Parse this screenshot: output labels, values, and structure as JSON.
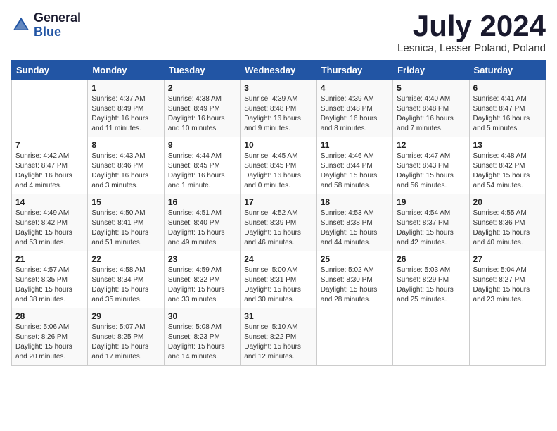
{
  "logo": {
    "general": "General",
    "blue": "Blue"
  },
  "header": {
    "month": "July 2024",
    "location": "Lesnica, Lesser Poland, Poland"
  },
  "weekdays": [
    "Sunday",
    "Monday",
    "Tuesday",
    "Wednesday",
    "Thursday",
    "Friday",
    "Saturday"
  ],
  "weeks": [
    [
      {
        "day": "",
        "info": ""
      },
      {
        "day": "1",
        "info": "Sunrise: 4:37 AM\nSunset: 8:49 PM\nDaylight: 16 hours\nand 11 minutes."
      },
      {
        "day": "2",
        "info": "Sunrise: 4:38 AM\nSunset: 8:49 PM\nDaylight: 16 hours\nand 10 minutes."
      },
      {
        "day": "3",
        "info": "Sunrise: 4:39 AM\nSunset: 8:48 PM\nDaylight: 16 hours\nand 9 minutes."
      },
      {
        "day": "4",
        "info": "Sunrise: 4:39 AM\nSunset: 8:48 PM\nDaylight: 16 hours\nand 8 minutes."
      },
      {
        "day": "5",
        "info": "Sunrise: 4:40 AM\nSunset: 8:48 PM\nDaylight: 16 hours\nand 7 minutes."
      },
      {
        "day": "6",
        "info": "Sunrise: 4:41 AM\nSunset: 8:47 PM\nDaylight: 16 hours\nand 5 minutes."
      }
    ],
    [
      {
        "day": "7",
        "info": "Sunrise: 4:42 AM\nSunset: 8:47 PM\nDaylight: 16 hours\nand 4 minutes."
      },
      {
        "day": "8",
        "info": "Sunrise: 4:43 AM\nSunset: 8:46 PM\nDaylight: 16 hours\nand 3 minutes."
      },
      {
        "day": "9",
        "info": "Sunrise: 4:44 AM\nSunset: 8:45 PM\nDaylight: 16 hours\nand 1 minute."
      },
      {
        "day": "10",
        "info": "Sunrise: 4:45 AM\nSunset: 8:45 PM\nDaylight: 16 hours\nand 0 minutes."
      },
      {
        "day": "11",
        "info": "Sunrise: 4:46 AM\nSunset: 8:44 PM\nDaylight: 15 hours\nand 58 minutes."
      },
      {
        "day": "12",
        "info": "Sunrise: 4:47 AM\nSunset: 8:43 PM\nDaylight: 15 hours\nand 56 minutes."
      },
      {
        "day": "13",
        "info": "Sunrise: 4:48 AM\nSunset: 8:42 PM\nDaylight: 15 hours\nand 54 minutes."
      }
    ],
    [
      {
        "day": "14",
        "info": "Sunrise: 4:49 AM\nSunset: 8:42 PM\nDaylight: 15 hours\nand 53 minutes."
      },
      {
        "day": "15",
        "info": "Sunrise: 4:50 AM\nSunset: 8:41 PM\nDaylight: 15 hours\nand 51 minutes."
      },
      {
        "day": "16",
        "info": "Sunrise: 4:51 AM\nSunset: 8:40 PM\nDaylight: 15 hours\nand 49 minutes."
      },
      {
        "day": "17",
        "info": "Sunrise: 4:52 AM\nSunset: 8:39 PM\nDaylight: 15 hours\nand 46 minutes."
      },
      {
        "day": "18",
        "info": "Sunrise: 4:53 AM\nSunset: 8:38 PM\nDaylight: 15 hours\nand 44 minutes."
      },
      {
        "day": "19",
        "info": "Sunrise: 4:54 AM\nSunset: 8:37 PM\nDaylight: 15 hours\nand 42 minutes."
      },
      {
        "day": "20",
        "info": "Sunrise: 4:55 AM\nSunset: 8:36 PM\nDaylight: 15 hours\nand 40 minutes."
      }
    ],
    [
      {
        "day": "21",
        "info": "Sunrise: 4:57 AM\nSunset: 8:35 PM\nDaylight: 15 hours\nand 38 minutes."
      },
      {
        "day": "22",
        "info": "Sunrise: 4:58 AM\nSunset: 8:34 PM\nDaylight: 15 hours\nand 35 minutes."
      },
      {
        "day": "23",
        "info": "Sunrise: 4:59 AM\nSunset: 8:32 PM\nDaylight: 15 hours\nand 33 minutes."
      },
      {
        "day": "24",
        "info": "Sunrise: 5:00 AM\nSunset: 8:31 PM\nDaylight: 15 hours\nand 30 minutes."
      },
      {
        "day": "25",
        "info": "Sunrise: 5:02 AM\nSunset: 8:30 PM\nDaylight: 15 hours\nand 28 minutes."
      },
      {
        "day": "26",
        "info": "Sunrise: 5:03 AM\nSunset: 8:29 PM\nDaylight: 15 hours\nand 25 minutes."
      },
      {
        "day": "27",
        "info": "Sunrise: 5:04 AM\nSunset: 8:27 PM\nDaylight: 15 hours\nand 23 minutes."
      }
    ],
    [
      {
        "day": "28",
        "info": "Sunrise: 5:06 AM\nSunset: 8:26 PM\nDaylight: 15 hours\nand 20 minutes."
      },
      {
        "day": "29",
        "info": "Sunrise: 5:07 AM\nSunset: 8:25 PM\nDaylight: 15 hours\nand 17 minutes."
      },
      {
        "day": "30",
        "info": "Sunrise: 5:08 AM\nSunset: 8:23 PM\nDaylight: 15 hours\nand 14 minutes."
      },
      {
        "day": "31",
        "info": "Sunrise: 5:10 AM\nSunset: 8:22 PM\nDaylight: 15 hours\nand 12 minutes."
      },
      {
        "day": "",
        "info": ""
      },
      {
        "day": "",
        "info": ""
      },
      {
        "day": "",
        "info": ""
      }
    ]
  ]
}
